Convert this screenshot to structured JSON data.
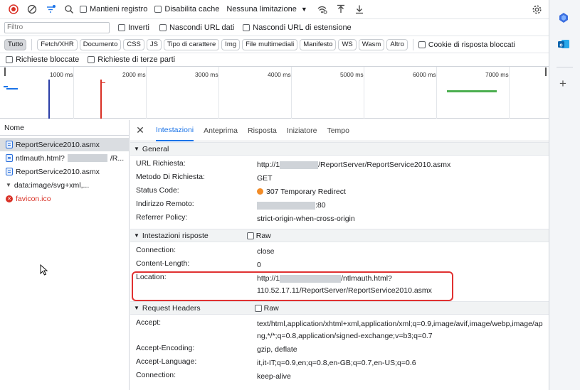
{
  "toolbar": {
    "preserve_log": "Mantieni registro",
    "disable_cache": "Disabilita cache",
    "throttling": "Nessuna limitazione"
  },
  "filterbar": {
    "filter_placeholder": "Filtro",
    "invert": "Inverti",
    "hide_data_urls": "Nascondi URL dati",
    "hide_extension_urls": "Nascondi URL di estensione"
  },
  "type_filters": [
    "Tutto",
    "Fetch/XHR",
    "Documento",
    "CSS",
    "JS",
    "Tipo di carattere",
    "Img",
    "File multimediali",
    "Manifesto",
    "WS",
    "Wasm",
    "Altro"
  ],
  "blocked_cookies": "Cookie di risposta bloccati",
  "blocked_requests": "Richieste bloccate",
  "third_party": "Richieste di terze parti",
  "overview_ticks": [
    "1000 ms",
    "2000 ms",
    "3000 ms",
    "4000 ms",
    "5000 ms",
    "6000 ms",
    "7000 ms"
  ],
  "requests": {
    "header": "Nome",
    "items": [
      {
        "name": "ReportService2010.asmx",
        "suffix": ""
      },
      {
        "name": "ntlmauth.html?",
        "suffix": "/R..."
      },
      {
        "name": "ReportService2010.asmx",
        "suffix": ""
      },
      {
        "name": "data:image/svg+xml,...",
        "suffix": ""
      },
      {
        "name": "favicon.ico",
        "suffix": ""
      }
    ]
  },
  "details": {
    "tabs": [
      "Intestazioni",
      "Anteprima",
      "Risposta",
      "Iniziatore",
      "Tempo"
    ],
    "general_title": "General",
    "general": {
      "url_key": "URL Richiesta:",
      "url_prefix": "http://1",
      "url_suffix": "/ReportServer/ReportService2010.asmx",
      "method_key": "Metodo Di Richiesta:",
      "method_val": "GET",
      "status_key": "Status Code:",
      "status_val": "307 Temporary Redirect",
      "remote_key": "Indirizzo Remoto:",
      "remote_suffix": ":80",
      "referrer_key": "Referrer Policy:",
      "referrer_val": "strict-origin-when-cross-origin"
    },
    "response_title": "Intestazioni risposte",
    "raw_label": "Raw",
    "response": {
      "conn_key": "Connection:",
      "conn_val": "close",
      "len_key": "Content-Length:",
      "len_val": "0",
      "loc_key": "Location:",
      "loc_prefix": "http://1",
      "loc_suffix": "/ntlmauth.html?",
      "loc_line2": "110.52.17.11/ReportServer/ReportService2010.asmx"
    },
    "request_title": "Request Headers",
    "request": {
      "accept_key": "Accept:",
      "accept_val": "text/html,application/xhtml+xml,application/xml;q=0.9,image/avif,image/webp,image/apng,*/*;q=0.8,application/signed-exchange;v=b3;q=0.7",
      "enc_key": "Accept-Encoding:",
      "enc_val": "gzip, deflate",
      "lang_key": "Accept-Language:",
      "lang_val": "it,it-IT;q=0.9,en;q=0.8,en-GB;q=0.7,en-US;q=0.6",
      "conn_key": "Connection:",
      "conn_val": "keep-alive"
    }
  },
  "colors": {
    "accent": "#1a73e8",
    "record": "#d93025",
    "highlight": "#e03131",
    "status_redirect": "#f28c28"
  }
}
